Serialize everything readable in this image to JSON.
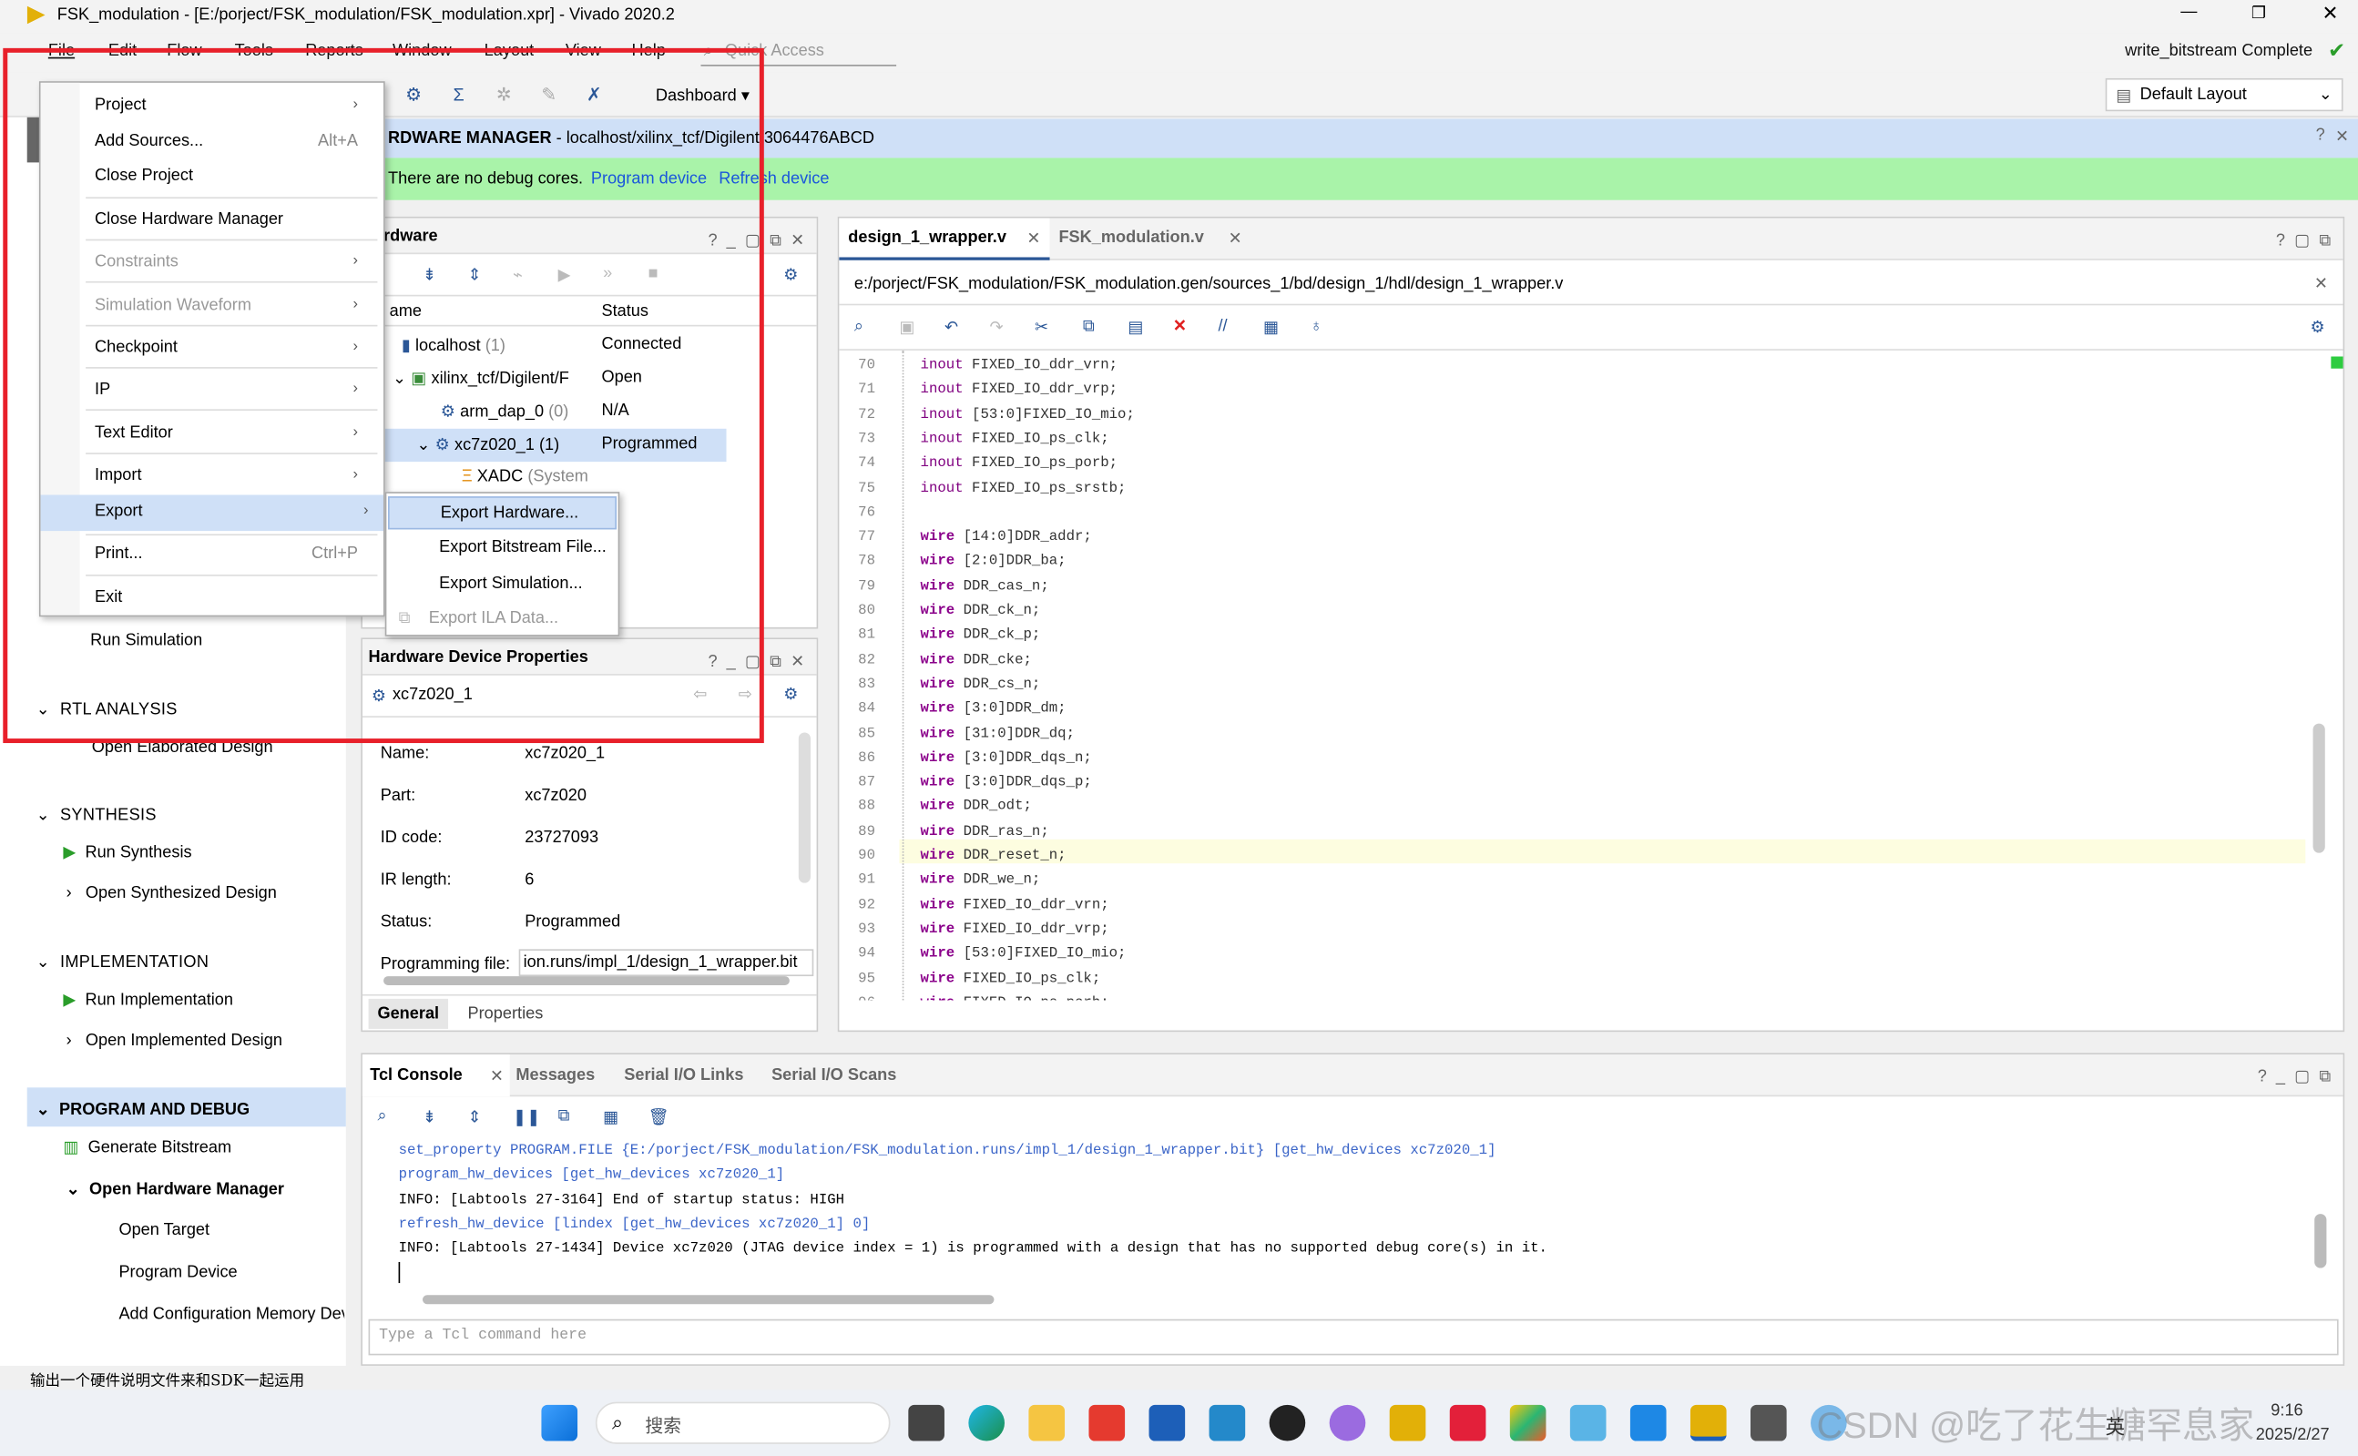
{
  "window": {
    "title": "FSK_modulation - [E:/porject/FSK_modulation/FSK_modulation.xpr] - Vivado 2020.2",
    "status": "write_bitstream Complete"
  },
  "menubar": {
    "items": [
      "File",
      "Edit",
      "Flow",
      "Tools",
      "Reports",
      "Window",
      "Layout",
      "View",
      "Help"
    ],
    "quick_access_placeholder": "Quick Access"
  },
  "toolbar": {
    "dashboard": "Dashboard",
    "layout": "Default Layout"
  },
  "file_menu": {
    "items": [
      {
        "label": "Project",
        "arrow": true
      },
      {
        "label": "Add Sources...",
        "shortcut": "Alt+A"
      },
      {
        "label": "Close Project"
      },
      {
        "label": "Close Hardware Manager"
      },
      {
        "label": "Constraints",
        "arrow": true,
        "disabled": true
      },
      {
        "label": "Simulation Waveform",
        "arrow": true,
        "disabled": true
      },
      {
        "label": "Checkpoint",
        "arrow": true
      },
      {
        "label": "IP",
        "arrow": true
      },
      {
        "label": "Text Editor",
        "arrow": true
      },
      {
        "label": "Import",
        "arrow": true
      },
      {
        "label": "Export",
        "arrow": true
      },
      {
        "label": "Print...",
        "shortcut": "Ctrl+P"
      },
      {
        "label": "Exit"
      }
    ]
  },
  "export_submenu": {
    "items": [
      "Export Hardware...",
      "Export Bitstream File...",
      "Export Simulation...",
      "Export ILA Data..."
    ]
  },
  "banner": {
    "title": "RDWARE MANAGER",
    "path": " - localhost/xilinx_tcf/Digilent/",
    "serial": "3064476ABCD"
  },
  "debug_bar": {
    "text": "There are no debug cores.",
    "program": "Program device",
    "refresh": "Refresh device"
  },
  "hardware": {
    "title": "rdware",
    "col_name": "ame",
    "col_status": "Status",
    "rows": [
      {
        "name": "localhost",
        "count": "(1)",
        "status": "Connected"
      },
      {
        "name": "xilinx_tcf/Digilent/F",
        "count": "",
        "status": "Open"
      },
      {
        "name": "arm_dap_0",
        "count": "(0)",
        "status": "N/A"
      },
      {
        "name": "xc7z020_1",
        "count": "(1)",
        "status": "Programmed"
      },
      {
        "name": "XADC",
        "count": "(System",
        "status": ""
      }
    ]
  },
  "device_props": {
    "title": "Hardware Device Properties",
    "device": "xc7z020_1",
    "props": [
      {
        "k": "Name:",
        "v": "xc7z020_1"
      },
      {
        "k": "Part:",
        "v": "xc7z020"
      },
      {
        "k": "ID code:",
        "v": "23727093"
      },
      {
        "k": "IR length:",
        "v": "6"
      },
      {
        "k": "Status:",
        "v": "Programmed"
      },
      {
        "k": "Programming file:",
        "v": "ion.runs/impl_1/design_1_wrapper.bit"
      }
    ],
    "tabs": [
      "General",
      "Properties"
    ]
  },
  "flow": {
    "run_simulation": "Run Simulation",
    "rtl": "RTL ANALYSIS",
    "open_elab": "Open Elaborated Design",
    "synthesis": "SYNTHESIS",
    "run_synth": "Run Synthesis",
    "open_synth": "Open Synthesized Design",
    "implementation": "IMPLEMENTATION",
    "run_impl": "Run Implementation",
    "open_impl": "Open Implemented Design",
    "prog": "PROGRAM AND DEBUG",
    "gen_bit": "Generate Bitstream",
    "open_hw": "Open Hardware Manager",
    "open_target": "Open Target",
    "program_device": "Program Device",
    "add_cfg": "Add Configuration Memory Dev"
  },
  "editor": {
    "tabs": [
      "design_1_wrapper.v",
      "FSK_modulation.v"
    ],
    "path": "e:/porject/FSK_modulation/FSK_modulation.gen/sources_1/bd/design_1/hdl/design_1_wrapper.v",
    "lines": [
      {
        "n": "70",
        "k": "inout",
        "t": " FIXED_IO_ddr_vrn;"
      },
      {
        "n": "71",
        "k": "inout",
        "t": " FIXED_IO_ddr_vrp;"
      },
      {
        "n": "72",
        "k": "inout",
        "t": " [53:0]FIXED_IO_mio;"
      },
      {
        "n": "73",
        "k": "inout",
        "t": " FIXED_IO_ps_clk;"
      },
      {
        "n": "74",
        "k": "inout",
        "t": " FIXED_IO_ps_porb;"
      },
      {
        "n": "75",
        "k": "inout",
        "t": " FIXED_IO_ps_srstb;"
      },
      {
        "n": "76",
        "k": "",
        "t": ""
      },
      {
        "n": "77",
        "k": "wire",
        "t": " [14:0]DDR_addr;"
      },
      {
        "n": "78",
        "k": "wire",
        "t": " [2:0]DDR_ba;"
      },
      {
        "n": "79",
        "k": "wire",
        "t": " DDR_cas_n;"
      },
      {
        "n": "80",
        "k": "wire",
        "t": " DDR_ck_n;"
      },
      {
        "n": "81",
        "k": "wire",
        "t": " DDR_ck_p;"
      },
      {
        "n": "82",
        "k": "wire",
        "t": " DDR_cke;"
      },
      {
        "n": "83",
        "k": "wire",
        "t": " DDR_cs_n;"
      },
      {
        "n": "84",
        "k": "wire",
        "t": " [3:0]DDR_dm;"
      },
      {
        "n": "85",
        "k": "wire",
        "t": " [31:0]DDR_dq;"
      },
      {
        "n": "86",
        "k": "wire",
        "t": " [3:0]DDR_dqs_n;"
      },
      {
        "n": "87",
        "k": "wire",
        "t": " [3:0]DDR_dqs_p;"
      },
      {
        "n": "88",
        "k": "wire",
        "t": " DDR_odt;"
      },
      {
        "n": "89",
        "k": "wire",
        "t": " DDR_ras_n;"
      },
      {
        "n": "90",
        "k": "wire",
        "t": " DDR_reset_n;"
      },
      {
        "n": "91",
        "k": "wire",
        "t": " DDR_we_n;"
      },
      {
        "n": "92",
        "k": "wire",
        "t": " FIXED_IO_ddr_vrn;"
      },
      {
        "n": "93",
        "k": "wire",
        "t": " FIXED_IO_ddr_vrp;"
      },
      {
        "n": "94",
        "k": "wire",
        "t": " [53:0]FIXED_IO_mio;"
      },
      {
        "n": "95",
        "k": "wire",
        "t": " FIXED_IO_ps_clk;"
      },
      {
        "n": "96",
        "k": "wire",
        "t": " FIXED_IO_ps_porb;"
      }
    ]
  },
  "console": {
    "tabs": [
      "Tcl Console",
      "Messages",
      "Serial I/O Links",
      "Serial I/O Scans"
    ],
    "placeholder": "Type a Tcl command here",
    "lines": [
      {
        "t": "set_property PROGRAM.FILE {E:/porject/FSK_modulation/FSK_modulation.runs/impl_1/design_1_wrapper.bit} [get_hw_devices xc7z020_1]",
        "blue": true
      },
      {
        "t": "program_hw_devices [get_hw_devices xc7z020_1]",
        "blue": true
      },
      {
        "t": "INFO: [Labtools 27-3164] End of startup status: HIGH",
        "blue": false
      },
      {
        "t": "refresh_hw_device [lindex [get_hw_devices xc7z020_1] 0]",
        "blue": true
      },
      {
        "t": "INFO: [Labtools 27-1434] Device xc7z020 (JTAG device index = 1) is programmed with a design that has no supported debug core(s) in it.",
        "blue": false
      }
    ]
  },
  "statusbar": {
    "text": "输出一个硬件说明文件来和SDK一起运用"
  },
  "taskbar": {
    "search": "搜索",
    "ime": "英",
    "time": "9:16",
    "date": "2025/2/27",
    "watermark": "CSDN @吃了花生糖罕息家"
  },
  "colors": {
    "highlight_red": "#e8202a",
    "selected": "#cfe0f7",
    "debug_green": "#a9f3a9"
  }
}
